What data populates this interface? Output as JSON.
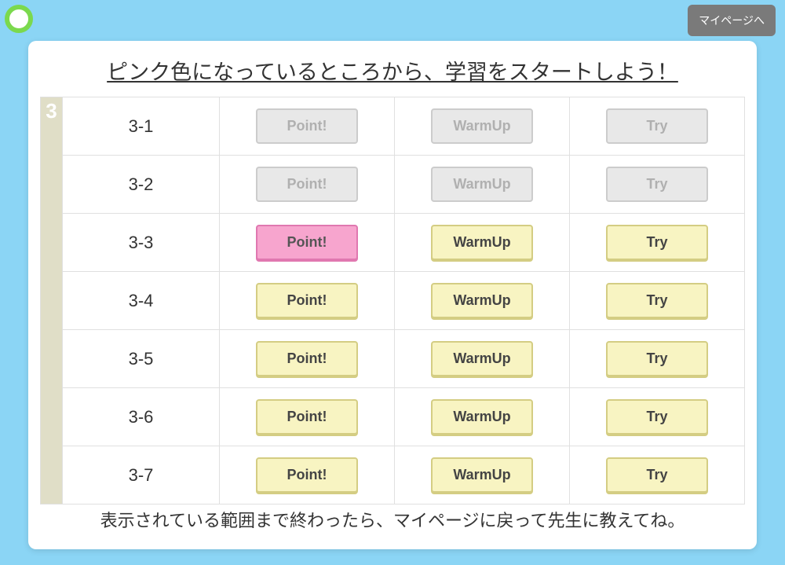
{
  "header": {
    "mypage_label": "マイページへ"
  },
  "title": "ピンク色になっているところから、学習をスタートしよう！",
  "section_number": "3",
  "button_labels": {
    "point": "Point!",
    "warmup": "WarmUp",
    "try": "Try"
  },
  "rows": [
    {
      "label": "3-1",
      "state": "disabled"
    },
    {
      "label": "3-2",
      "state": "disabled"
    },
    {
      "label": "3-3",
      "state": "pink"
    },
    {
      "label": "3-4",
      "state": "active"
    },
    {
      "label": "3-5",
      "state": "active"
    },
    {
      "label": "3-6",
      "state": "active"
    },
    {
      "label": "3-7",
      "state": "active"
    }
  ],
  "footer": "表示されている範囲まで終わったら、マイページに戻って先生に教えてね。"
}
